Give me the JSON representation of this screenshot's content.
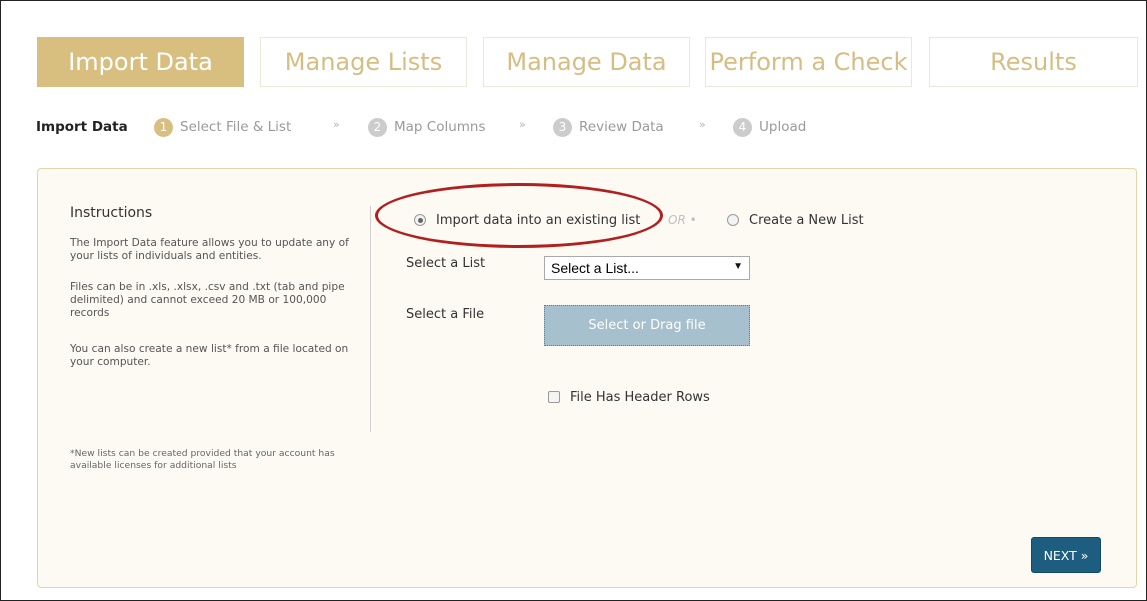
{
  "tabs": [
    {
      "label": "Import Data",
      "active": true
    },
    {
      "label": "Manage Lists",
      "active": false
    },
    {
      "label": "Manage Data",
      "active": false
    },
    {
      "label": "Perform a Check",
      "active": false
    },
    {
      "label": "Results",
      "active": false
    }
  ],
  "stepbar": {
    "title": "Import Data",
    "steps": [
      {
        "num": "1",
        "label": "Select File & List",
        "active": true
      },
      {
        "num": "2",
        "label": "Map Columns",
        "active": false
      },
      {
        "num": "3",
        "label": "Review Data",
        "active": false
      },
      {
        "num": "4",
        "label": "Upload",
        "active": false
      }
    ],
    "separator": "»"
  },
  "instructions": {
    "title": "Instructions",
    "paragraphs": [
      "The Import Data feature allows you to update any of your lists of individuals and entities.",
      "Files can be in .xls, .xlsx, .csv and .txt (tab and pipe delimited) and cannot exceed 20 MB or 100,000 records",
      "You can also create a new list* from a file located on your computer."
    ],
    "note": "*New lists can be created provided that your account has available licenses for additional lists"
  },
  "form": {
    "option_existing": "Import data into an existing list",
    "option_existing_selected": true,
    "or_text": "OR •",
    "option_new": "Create a New List",
    "option_new_selected": false,
    "select_list_label": "Select a List",
    "select_list_value": "Select a List...",
    "select_file_label": "Select a File",
    "file_button": "Select or Drag file",
    "header_rows_label": "File Has Header Rows",
    "header_rows_checked": false
  },
  "next_button": "NEXT »",
  "colors": {
    "accent_gold": "#d8bf80",
    "highlight_red": "#b02020",
    "next_blue": "#1c5d80",
    "file_button_blue": "#a6c0ce"
  }
}
